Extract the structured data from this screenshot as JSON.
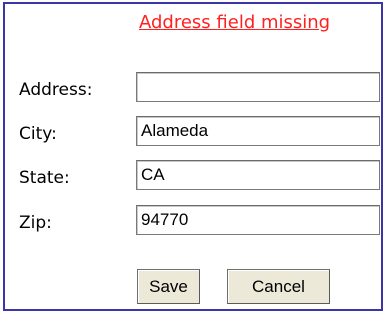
{
  "form": {
    "error_message": "Address field missing",
    "fields": [
      {
        "label": "Address:",
        "value": ""
      },
      {
        "label": "City:",
        "value": "Alameda"
      },
      {
        "label": "State:",
        "value": "CA"
      },
      {
        "label": "Zip:",
        "value": "94770"
      }
    ],
    "buttons": {
      "save_label": "Save",
      "cancel_label": "Cancel"
    }
  },
  "colors": {
    "error": "#ff2020",
    "border": "#3a36a8",
    "button_face": "#ece9d8"
  }
}
